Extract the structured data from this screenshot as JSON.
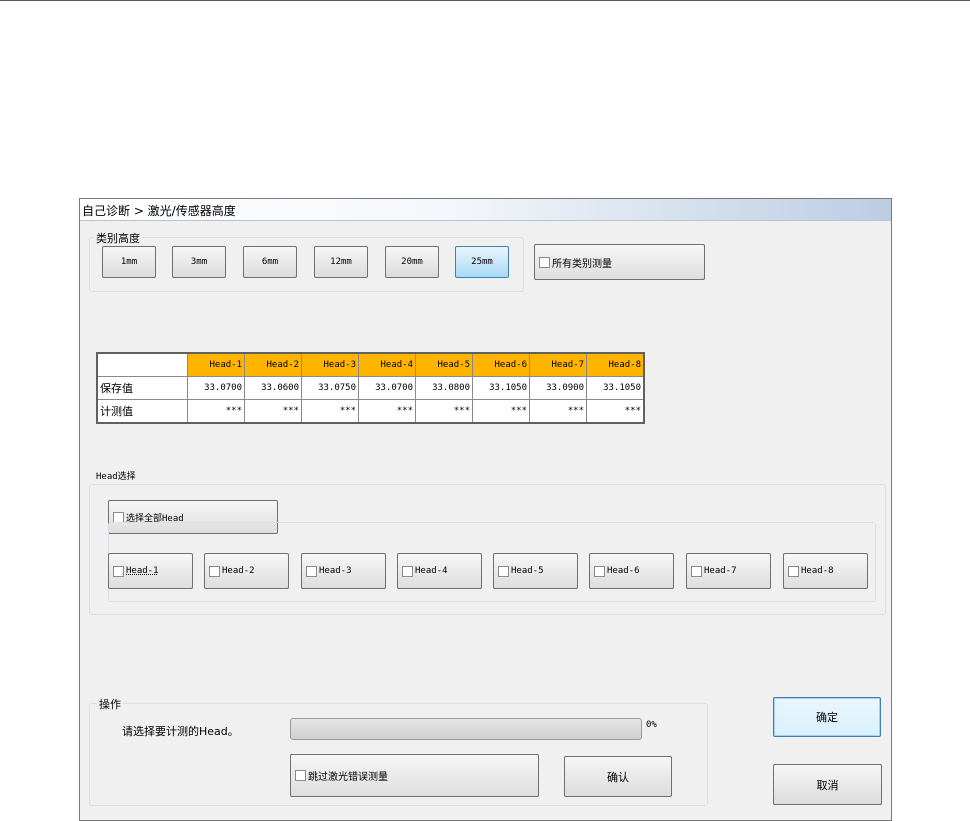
{
  "window": {
    "title": "自己诊断 > 激光/传感器高度"
  },
  "height_group": {
    "label": "类别高度",
    "buttons": [
      "1mm",
      "3mm",
      "6mm",
      "12mm",
      "20mm",
      "25mm"
    ],
    "selected": "25mm",
    "all_measure_label": "所有类别测量"
  },
  "table": {
    "headers": [
      "Head-1",
      "Head-2",
      "Head-3",
      "Head-4",
      "Head-5",
      "Head-6",
      "Head-7",
      "Head-8"
    ],
    "rows": [
      {
        "label": "保存值",
        "values": [
          "33.0700",
          "33.0600",
          "33.0750",
          "33.0700",
          "33.0800",
          "33.1050",
          "33.0900",
          "33.1050"
        ]
      },
      {
        "label": "计测值",
        "values": [
          "***",
          "***",
          "***",
          "***",
          "***",
          "***",
          "***",
          "***"
        ]
      }
    ]
  },
  "head_select": {
    "label": "Head选择",
    "select_all_label": "选择全部Head",
    "heads": [
      "Head-1",
      "Head-2",
      "Head-3",
      "Head-4",
      "Head-5",
      "Head-6",
      "Head-7",
      "Head-8"
    ]
  },
  "operation": {
    "label": "操作",
    "prompt": "请选择要计测的Head。",
    "progress_percent": 0,
    "progress_text": "0%",
    "skip_laser_error_label": "跳过激光错误测量",
    "confirm_label": "确认"
  },
  "dialog": {
    "ok_label": "确定",
    "cancel_label": "取消"
  },
  "colors": {
    "header_fill": "#ffb400",
    "accent": "#3c7fb1"
  }
}
